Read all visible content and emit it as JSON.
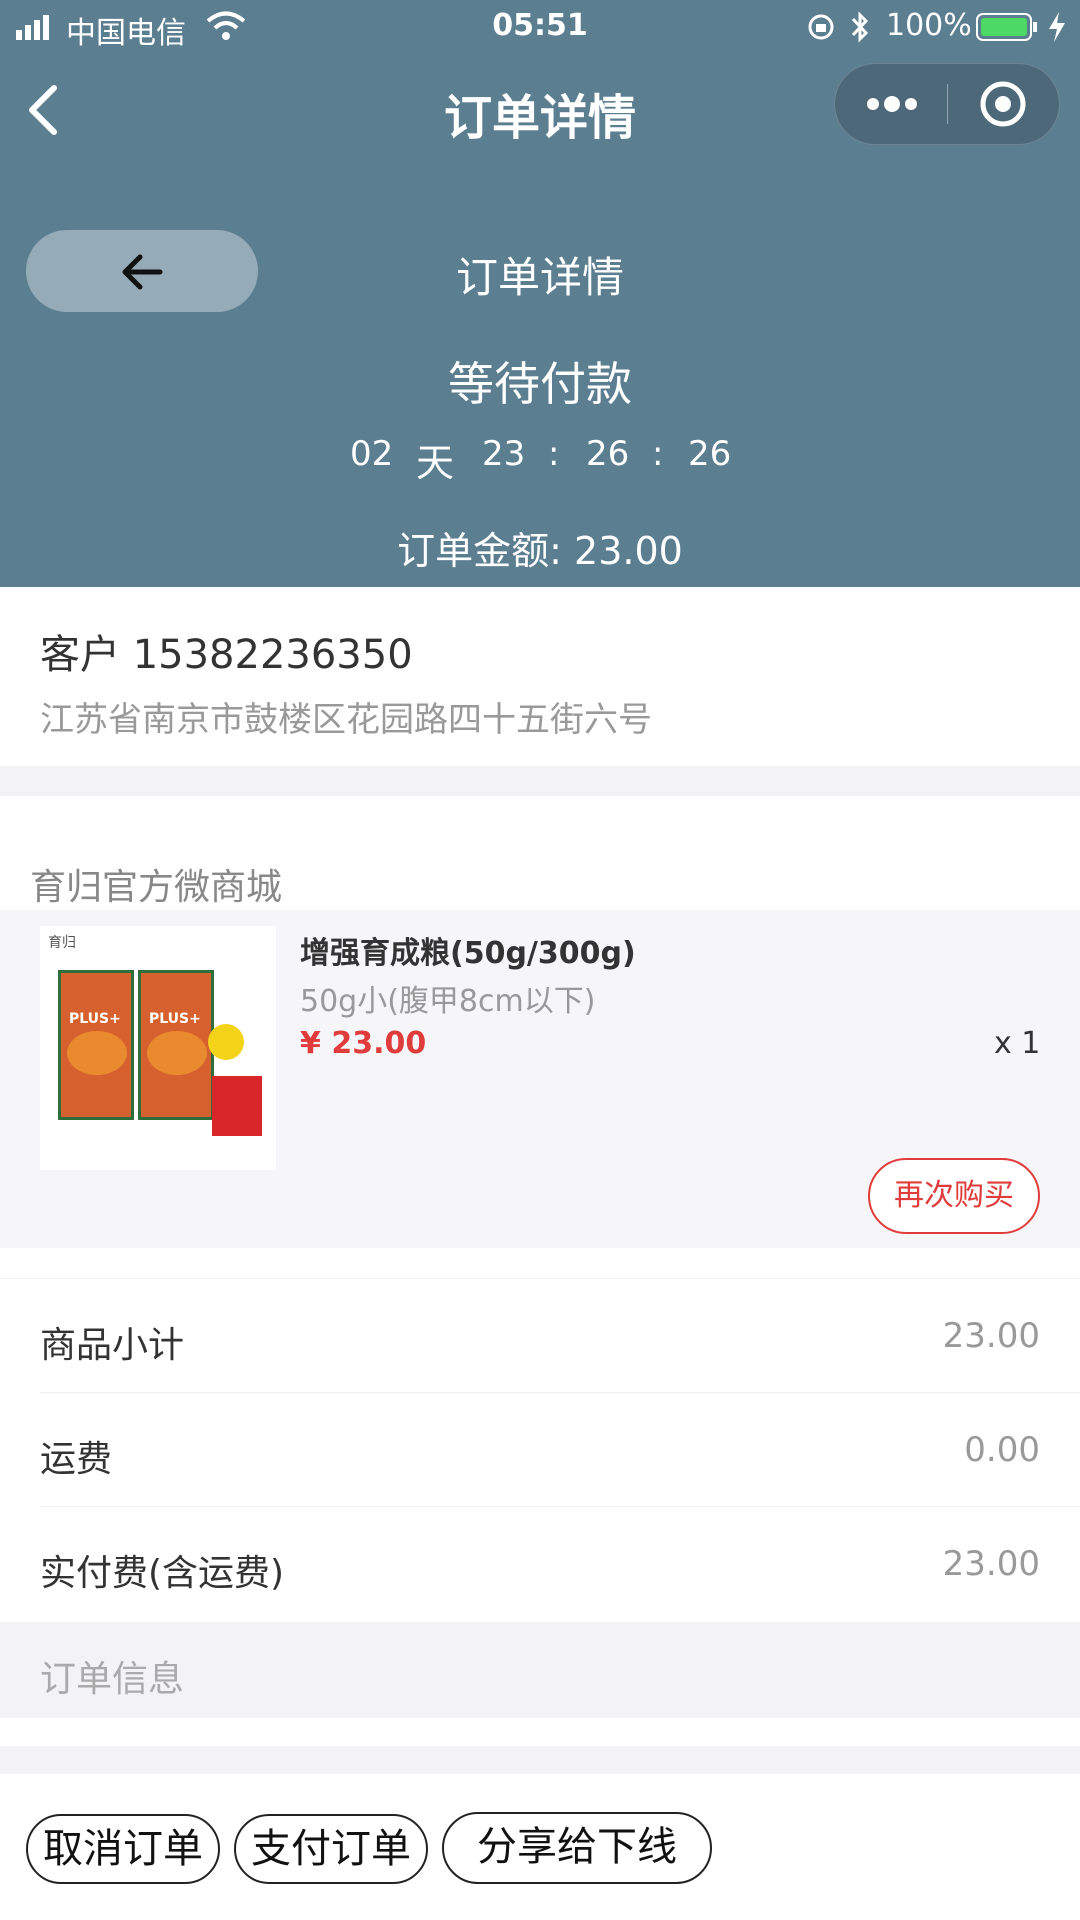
{
  "status_bar": {
    "carrier": "中国电信",
    "time": "05:51",
    "battery": "100%"
  },
  "nav": {
    "title": "订单详情"
  },
  "header": {
    "title": "订单详情",
    "status": "等待付款",
    "countdown": {
      "days": "02",
      "day_unit": "天",
      "hours": "23",
      "minutes": "26",
      "seconds": "26",
      "sep": ":"
    },
    "amount": "订单金额: 23.00"
  },
  "customer": {
    "name_phone": "客户 15382236350",
    "address": "江苏省南京市鼓楼区花园路四十五街六号"
  },
  "store": {
    "name": "育归官方微商城"
  },
  "product": {
    "name": "增强育成粮(50g/300g)",
    "variant": "50g小(腹甲8cm以下)",
    "price": "¥ 23.00",
    "quantity": "x 1",
    "rebuy_label": "再次购买",
    "image_brand": "育归",
    "image_badge": "PLUS+"
  },
  "summary": [
    {
      "label": "商品小计",
      "value": "23.00"
    },
    {
      "label": "运费",
      "value": "0.00"
    },
    {
      "label": "实付费(含运费)",
      "value": "23.00"
    }
  ],
  "order_info": {
    "title": "订单信息"
  },
  "actions": {
    "cancel": "取消订单",
    "pay": "支付订单",
    "share": "分享给下线"
  },
  "colors": {
    "header_bg": "#5c7e91",
    "price_red": "#e03c3c",
    "page_bg": "#f3f3f5"
  }
}
